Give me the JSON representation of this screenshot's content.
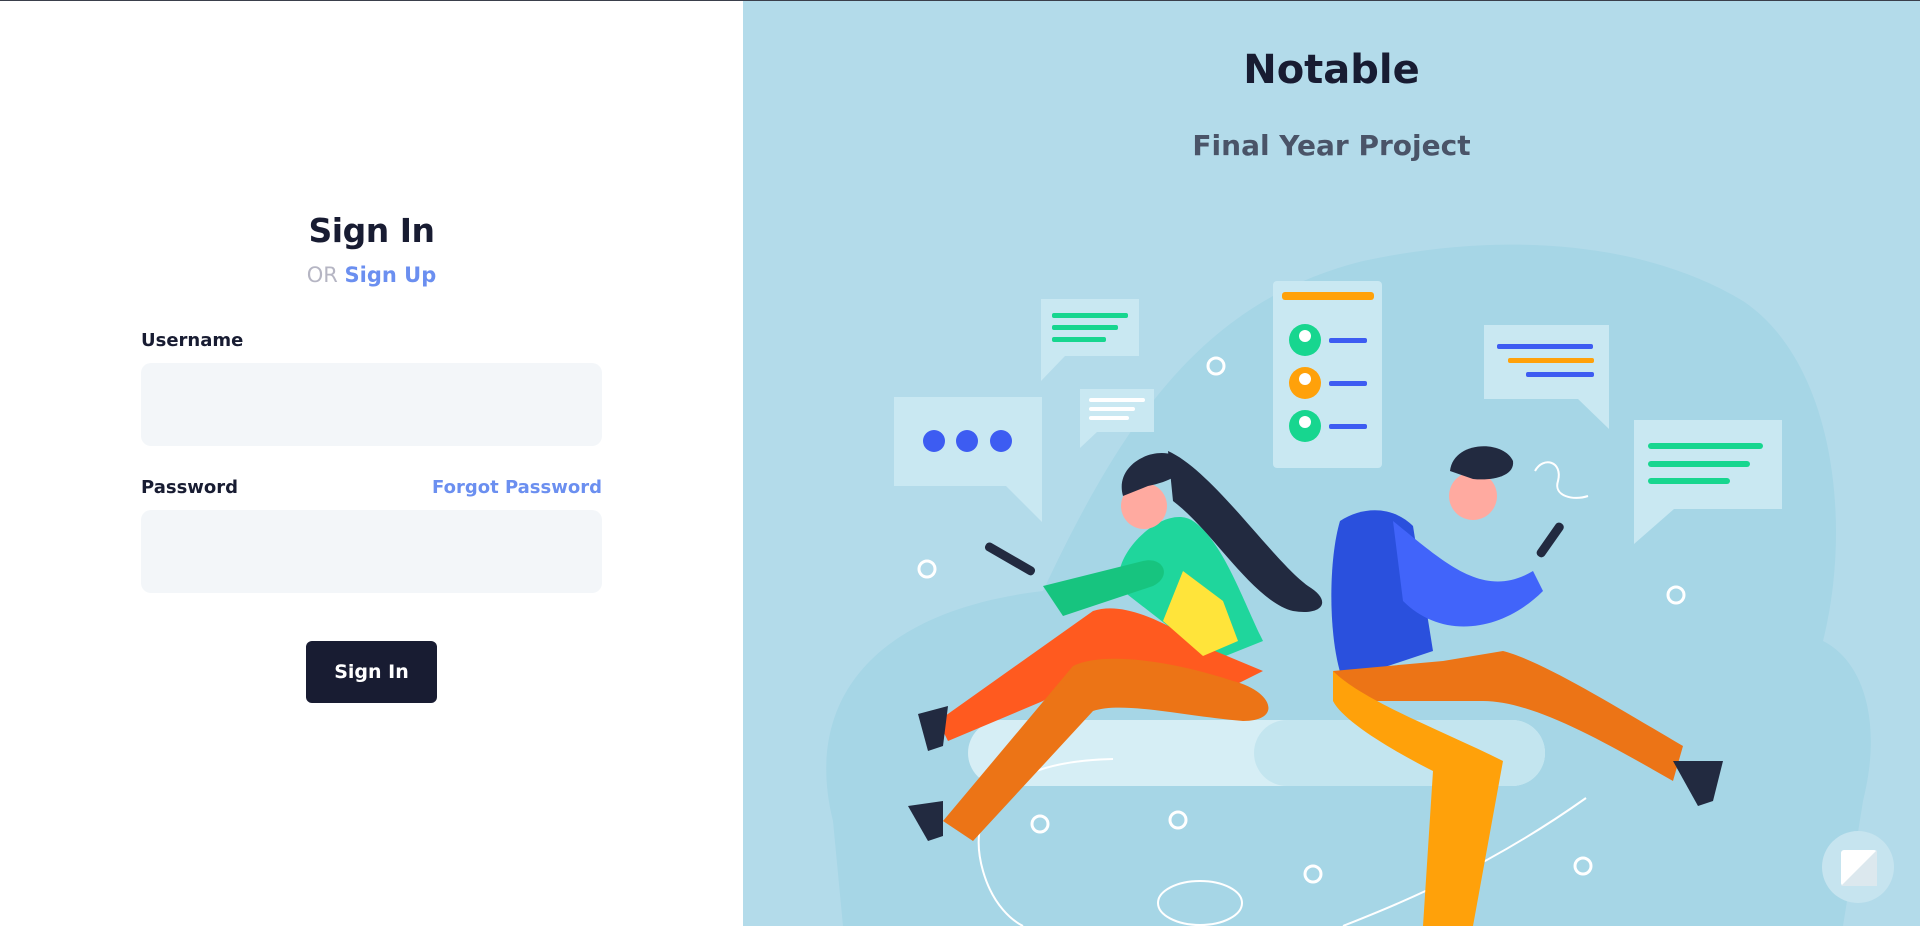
{
  "signin": {
    "title": "Sign In",
    "or_text": "OR",
    "signup_link": "Sign Up",
    "username_label": "Username",
    "username_value": "",
    "password_label": "Password",
    "password_value": "",
    "forgot_link": "Forgot Password",
    "submit_label": "Sign In"
  },
  "hero": {
    "brand": "Notable",
    "subtitle": "Final Year Project"
  },
  "icons": {
    "chat_fab": "chat-widget-icon"
  },
  "colors": {
    "primary_dark": "#181c32",
    "link_blue": "#6b8ff0",
    "hero_bg": "#b3dbea",
    "input_bg": "#f3f6f9"
  }
}
